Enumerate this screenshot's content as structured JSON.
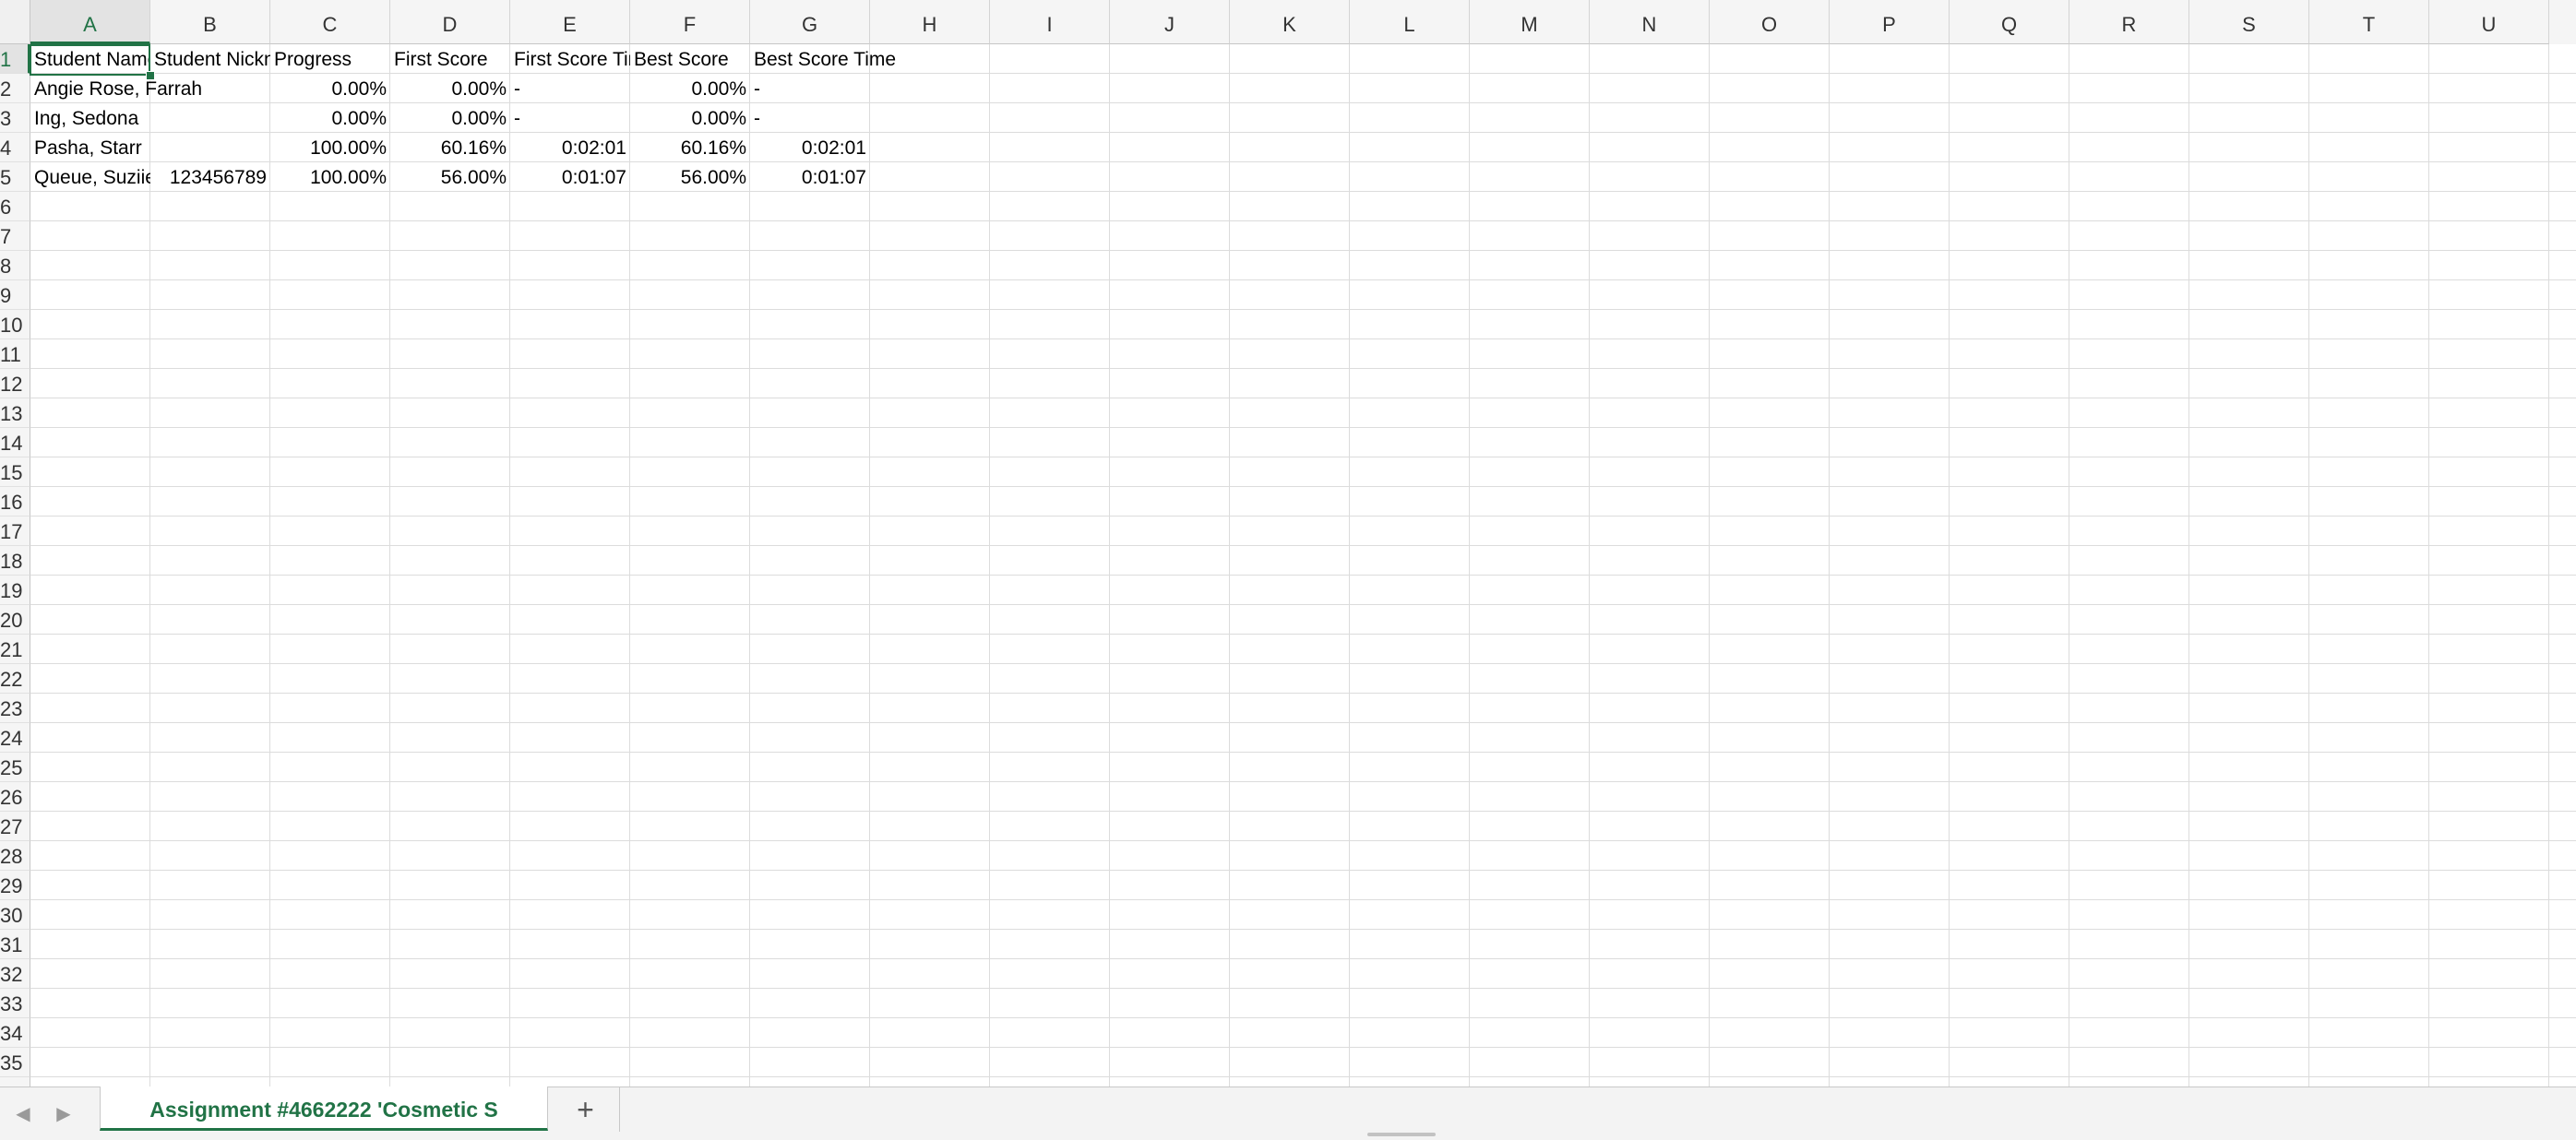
{
  "columns": [
    "A",
    "B",
    "C",
    "D",
    "E",
    "F",
    "G",
    "H",
    "I",
    "J",
    "K",
    "L",
    "M",
    "N",
    "O",
    "P",
    "Q",
    "R",
    "S",
    "T",
    "U"
  ],
  "active_column": "A",
  "active_row": 1,
  "row_count": 35,
  "rows": [
    [
      "Student Name",
      "Student Nickname",
      "Progress",
      "First Score",
      "First Score Time",
      "Best Score",
      "Best Score Time"
    ],
    [
      "Angie Rose, Farrah",
      "",
      "0.00%",
      "0.00%",
      "-",
      "0.00%",
      "-"
    ],
    [
      "Ing, Sedona",
      "",
      "0.00%",
      "0.00%",
      "-",
      "0.00%",
      "-"
    ],
    [
      "Pasha, Starr",
      "",
      "100.00%",
      "60.16%",
      "0:02:01",
      "60.16%",
      "0:02:01"
    ],
    [
      "Queue, Suziie",
      "123456789",
      "100.00%",
      "56.00%",
      "0:01:07",
      "56.00%",
      "0:01:07"
    ]
  ],
  "sheet_tab": {
    "label": "Assignment #4662222 'Cosmetic S"
  },
  "add_sheet_label": "+",
  "nav": {
    "prev_icon": "◀",
    "next_icon": "▶"
  },
  "colors": {
    "accent": "#217346",
    "grid": "#dcdcdc",
    "header_bg": "#f5f5f5"
  },
  "icons": {
    "prev_sheet": "chevron-left-icon",
    "next_sheet": "chevron-right-icon",
    "add_sheet": "plus-icon"
  }
}
